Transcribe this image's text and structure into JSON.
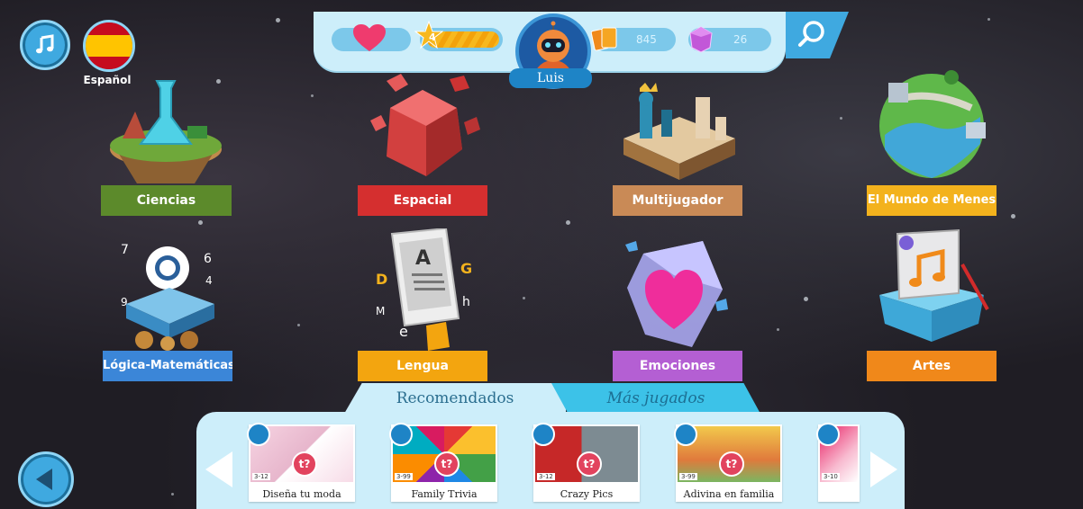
{
  "header": {
    "music_icon": "music-note-icon",
    "language_label": "Español",
    "level": "4",
    "coins": "845",
    "gems": "26",
    "player_name": "Luis"
  },
  "categories": [
    {
      "label": "Ciencias",
      "color": "#5c8a2b"
    },
    {
      "label": "Espacial",
      "color": "#d52f2f"
    },
    {
      "label": "Multijugador",
      "color": "#c98a56"
    },
    {
      "label": "El Mundo de Menes",
      "color": "#f3b21d"
    },
    {
      "label": "Lógica-Matemáticas",
      "color": "#3b86d8"
    },
    {
      "label": "Lengua",
      "color": "#f3a50f"
    },
    {
      "label": "Emociones",
      "color": "#b45fd3"
    },
    {
      "label": "Artes",
      "color": "#f0881a"
    }
  ],
  "tabs": {
    "recommended": "Recomendados",
    "most_played": "Más jugados"
  },
  "games": [
    {
      "title": "Diseña tu moda",
      "age": "3-12"
    },
    {
      "title": "Family Trivia",
      "age": "3-99"
    },
    {
      "title": "Crazy Pics",
      "age": "3-12"
    },
    {
      "title": "Adivina en familia",
      "age": "3-99"
    },
    {
      "title": "",
      "age": "3-10"
    }
  ],
  "colors": {
    "accent": "#3fa9e0",
    "panel": "#cdeefa",
    "tab_active": "#3cc2e8",
    "heart": "#ef3b6e",
    "badge": "#e2435e"
  }
}
